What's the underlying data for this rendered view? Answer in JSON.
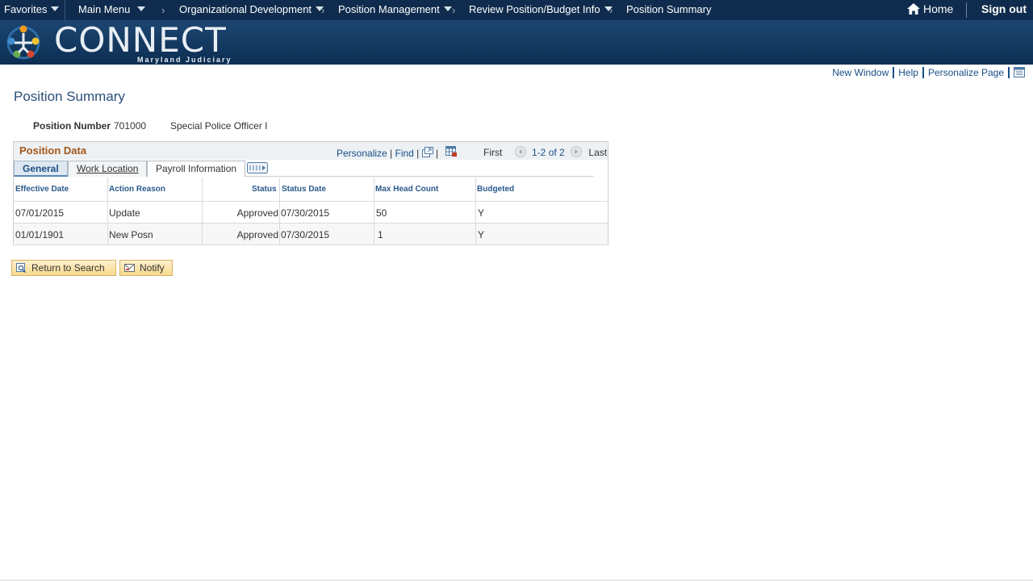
{
  "nav": {
    "favorites": "Favorites",
    "main_menu": "Main Menu",
    "breadcrumbs": [
      "Organizational Development",
      "Position Management",
      "Review Position/Budget Info",
      "Position Summary"
    ],
    "home": "Home",
    "signout": "Sign out"
  },
  "banner": {
    "logo": "CONNECT",
    "subtitle": "Maryland Judiciary"
  },
  "util": {
    "new_window": "New Window",
    "help": "Help",
    "personalize_page": "Personalize Page"
  },
  "page": {
    "title": "Position Summary",
    "position_number_label": "Position Number",
    "position_number": "701000",
    "position_desc": "Special Police Officer I"
  },
  "grid": {
    "title": "Position Data",
    "personalize": "Personalize",
    "find": "Find",
    "first": "First",
    "range": "1-2 of 2",
    "last": "Last",
    "tabs": [
      "General",
      "Work Location",
      "Payroll Information"
    ],
    "columns": [
      "Effective Date",
      "Action Reason",
      "Status",
      "Status Date",
      "Max Head Count",
      "Budgeted"
    ],
    "rows": [
      [
        "07/01/2015",
        "Update",
        "Approved",
        "07/30/2015",
        "50",
        "Y"
      ],
      [
        "01/01/1901",
        "New Posn",
        "Approved",
        "07/30/2015",
        "1",
        "Y"
      ]
    ]
  },
  "buttons": {
    "return_to_search": "Return to Search",
    "notify": "Notify"
  },
  "colors": {
    "nav_bg": "#0f2c4e",
    "title_blue": "#2b4f77",
    "link_blue": "#1a4f86",
    "grid_title": "#a3571a",
    "button_bg": "#f7d98c"
  }
}
